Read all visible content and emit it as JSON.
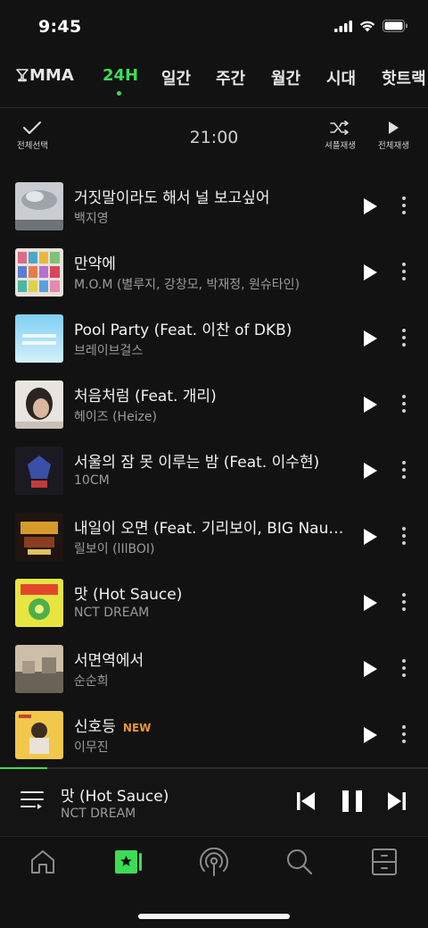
{
  "status": {
    "time": "9:45"
  },
  "tabs": [
    {
      "label": "MMA",
      "icon": "trophy-icon"
    },
    {
      "label": "24H",
      "active": true
    },
    {
      "label": "일간"
    },
    {
      "label": "주간"
    },
    {
      "label": "월간"
    },
    {
      "label": "시대"
    },
    {
      "label": "핫트랙"
    }
  ],
  "toolbar": {
    "select_all": "전체선택",
    "time": "21:00",
    "shuffle": "셔플재생",
    "play_all": "전체재생"
  },
  "songs": [
    {
      "title": "거짓말이라도 해서 널 보고싶어",
      "artist": "백지영"
    },
    {
      "title": "만약에",
      "artist": "M.O.M (별루지, 강창모, 박재정, 원슈타인)"
    },
    {
      "title": "Pool Party (Feat. 이찬 of DKB)",
      "artist": "브레이브걸스"
    },
    {
      "title": "처음처럼 (Feat. 개리)",
      "artist": "헤이즈 (Heize)"
    },
    {
      "title": "서울의 잠 못 이루는 밤 (Feat. 이수현)",
      "artist": "10CM"
    },
    {
      "title": "내일이 오면 (Feat. 기리보이, BIG Naughty)",
      "artist": "릴보이 (lIlBOI)"
    },
    {
      "title": "맛 (Hot Sauce)",
      "artist": "NCT DREAM"
    },
    {
      "title": "서면역에서",
      "artist": "순순희"
    },
    {
      "title": "신호등",
      "artist": "이무진",
      "badge": "NEW"
    }
  ],
  "player": {
    "title": "맛 (Hot Sauce)",
    "artist": "NCT DREAM",
    "progress": 0.11
  },
  "nav": [
    "home-icon",
    "chart-icon",
    "podcast-icon",
    "search-icon",
    "library-icon"
  ],
  "colors": {
    "accent": "#3ddc55",
    "badge": "#e9962b",
    "background": "#121212"
  }
}
